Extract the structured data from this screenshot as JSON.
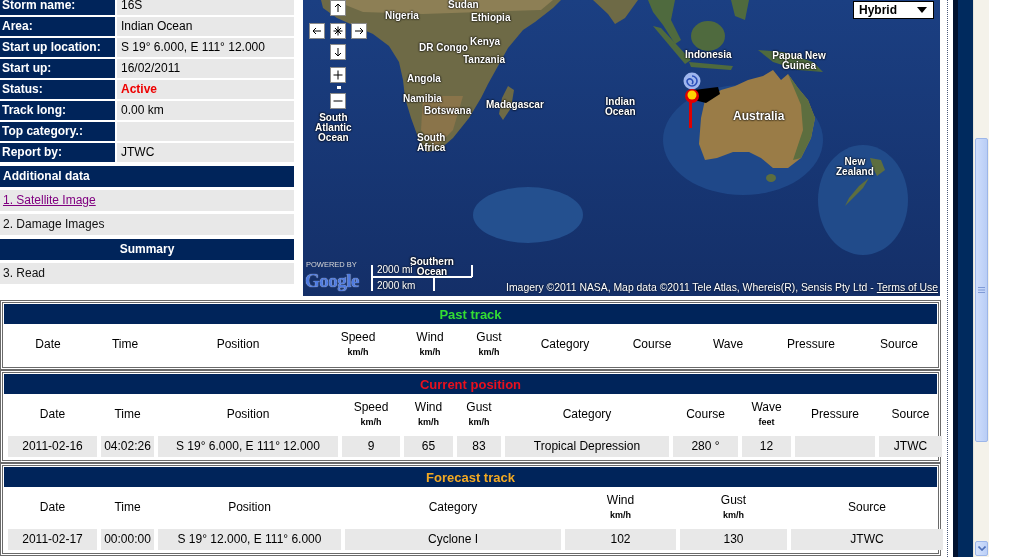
{
  "storm_info": [
    {
      "label": "Storm name:",
      "value": "16S",
      "kind": "text"
    },
    {
      "label": "Area:",
      "value": "Indian Ocean",
      "kind": "text"
    },
    {
      "label": "Start up location:",
      "value": "S 19° 6.000, E 111° 12.000",
      "kind": "text"
    },
    {
      "label": "Start up:",
      "value": "16/02/2011",
      "kind": "text"
    },
    {
      "label": "Status:",
      "value": "Active",
      "kind": "status"
    },
    {
      "label": "Track long:",
      "value": "0.00 km",
      "kind": "text"
    },
    {
      "label": "Top category.:",
      "kind": "text"
    },
    {
      "label": "Report by:",
      "value": "JTWC",
      "kind": "text"
    }
  ],
  "additional_data": {
    "title": "Additional data",
    "items": [
      {
        "text": "1. Satellite Image",
        "kind": "link"
      },
      {
        "text": "2. Damage Images",
        "kind": "text"
      }
    ]
  },
  "summary": {
    "title": "Summary",
    "items": [
      {
        "text": "3. Read",
        "kind": "text"
      }
    ]
  },
  "map": {
    "labels": [
      "Sudan",
      "Nigeria",
      "Ethiopia",
      "Kenya",
      "DR Congo",
      "Tanzania",
      "Angola",
      "Namibia",
      "Botswana",
      "Madagascar",
      "South Atlantic Ocean",
      "South Africa",
      "Indian Ocean",
      "Southern Ocean",
      "Indonesia",
      "Papua New Guinea",
      "Australia",
      "New Zealand"
    ],
    "map_type": "Hybrid",
    "logo": {
      "caption": "POWERED BY",
      "text": "Google"
    },
    "scale": {
      "miles": "2000 mi",
      "kilometres": "2000 km"
    },
    "attribution": {
      "text": "Imagery ©2011 NASA, Map data ©2011 Tele Atlas, Whereis(R), Sensis Pty Ltd -",
      "link": "Terms of Use"
    }
  },
  "tracks": [
    {
      "title": "Past track",
      "color": "#33dd33",
      "columns": [
        {
          "label": "Date"
        },
        {
          "label": "Time"
        },
        {
          "label": "Position"
        },
        {
          "label": "Speed",
          "unit": "km/h"
        },
        {
          "label": "Wind",
          "unit": "km/h"
        },
        {
          "label": "Gust",
          "unit": "km/h"
        },
        {
          "label": "Category"
        },
        {
          "label": "Course"
        },
        {
          "label": "Wave"
        },
        {
          "label": "Pressure"
        },
        {
          "label": "Source"
        }
      ]
    },
    {
      "title": "Current position",
      "color": "#e8101e",
      "columns": [
        {
          "label": "Date"
        },
        {
          "label": "Time"
        },
        {
          "label": "Position"
        },
        {
          "label": "Speed",
          "unit": "km/h"
        },
        {
          "label": "Wind",
          "unit": "km/h"
        },
        {
          "label": "Gust",
          "unit": "km/h"
        },
        {
          "label": "Category"
        },
        {
          "label": "Course"
        },
        {
          "label": "Wave",
          "unit": "feet"
        },
        {
          "label": "Pressure"
        },
        {
          "label": "Source"
        }
      ],
      "rows": [
        [
          "2011-02-16",
          "04:02:26",
          "S 19° 6.000, E 111° 12.000",
          "9",
          "65",
          "83",
          "Tropical Depression",
          "280 °",
          "12",
          null,
          "JTWC"
        ]
      ]
    },
    {
      "title": "Forecast track",
      "color": "#f2a922",
      "columns": [
        {
          "label": "Date"
        },
        {
          "label": "Time"
        },
        {
          "label": "Position"
        },
        {
          "label": "Category"
        },
        {
          "label": "Wind",
          "unit": "km/h"
        },
        {
          "label": "Gust",
          "unit": "km/h"
        },
        {
          "label": "Source"
        }
      ],
      "rows": [
        [
          "2011-02-17",
          "00:00:00",
          "S 19° 12.000, E 111° 6.000",
          "Cyclone I",
          "102",
          "130",
          "JTWC"
        ]
      ]
    }
  ]
}
